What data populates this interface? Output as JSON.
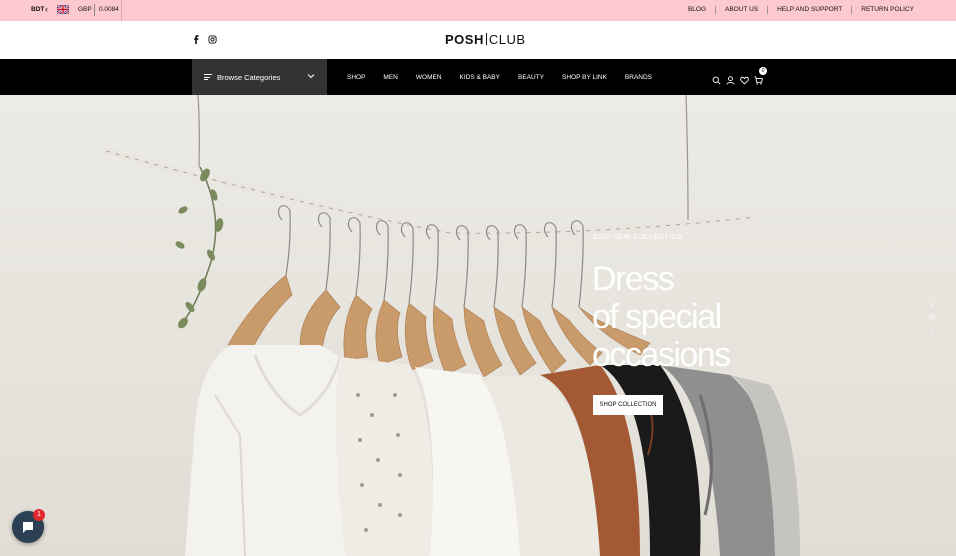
{
  "topbar": {
    "currency": "BDT",
    "flag_icon": "uk-flag-icon",
    "alt_currency": "GBP",
    "rate": "0.0084",
    "links": [
      "BLOG",
      "ABOUT US",
      "HELP AND SUPPORT",
      "RETURN POLICY"
    ]
  },
  "logo": {
    "part1": "POSH",
    "part2": "CLUB"
  },
  "social": [
    "facebook-icon",
    "instagram-icon"
  ],
  "nav": {
    "browse_label": "Browse Categories",
    "menu": [
      "SHOP",
      "MEN",
      "WOMEN",
      "KIDS & BABY",
      "BEAUTY",
      "SHOP BY LINK",
      "BRANDS"
    ],
    "icons": [
      "search-icon",
      "user-icon",
      "heart-icon",
      "cart-icon"
    ],
    "cart_count": "0"
  },
  "hero": {
    "subtitle": "2020 NEW COLLECTION",
    "headline_line1": "Dress",
    "headline_line2": "of special",
    "headline_line3": "occasions",
    "button_label": "SHOP COLLECTION",
    "slide_number": "06"
  },
  "chat": {
    "badge": "1"
  },
  "colors": {
    "topbar_bg": "#fcc9cf",
    "nav_bg": "#000000",
    "browse_bg": "#333333",
    "chat_bg": "#2b3f55",
    "badge": "#e0282e"
  }
}
